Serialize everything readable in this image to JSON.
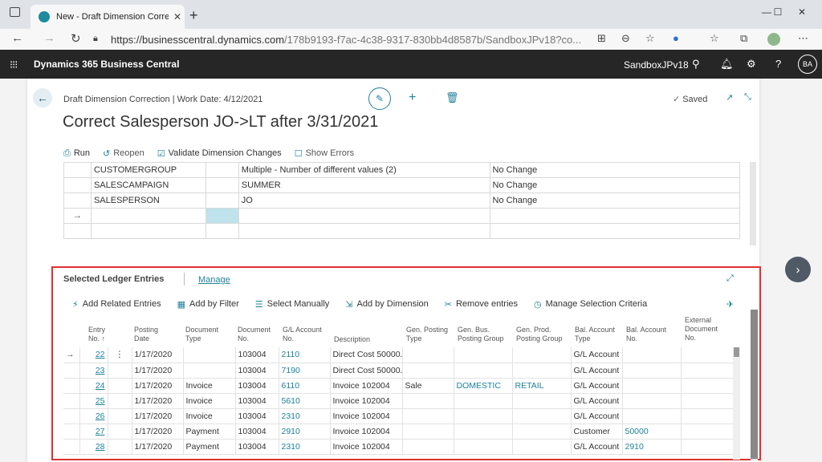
{
  "browser": {
    "tab_title": "New - Draft Dimension Correction",
    "tab_close": "✕",
    "url_host": "https://businesscentral.dynamics.com",
    "url_path": "/178b9193-f7ac-4c38-9317-830bb4d8587b/SandboxJPv18?co...",
    "window": {
      "minimize": "—",
      "maximize": "☐",
      "close": "✕"
    }
  },
  "bc": {
    "app_name": "Dynamics 365 Business Central",
    "environment": "SandboxJPv18",
    "avatar": "BA"
  },
  "page": {
    "breadcrumb": "Draft Dimension Correction | Work Date: 4/12/2021",
    "title": "Correct Salesperson JO->LT after 3/31/2021",
    "saved": "Saved",
    "actions": [
      {
        "label": "Run",
        "icon": "run-icon"
      },
      {
        "label": "Reopen",
        "icon": "reopen-icon"
      },
      {
        "label": "Validate Dimension Changes",
        "icon": "validate-icon"
      },
      {
        "label": "Show Errors",
        "icon": "errors-icon"
      }
    ]
  },
  "dimensions": {
    "rows": [
      {
        "code": "CUSTOMERGROUP",
        "value": "Multiple - Number of different values (2)",
        "new": "No Change"
      },
      {
        "code": "SALESCAMPAIGN",
        "value": "SUMMER",
        "new": "No Change"
      },
      {
        "code": "SALESPERSON",
        "value": "JO",
        "new": "No Change"
      },
      {
        "code": "",
        "value": "",
        "new": ""
      },
      {
        "code": "",
        "value": "",
        "new": ""
      }
    ],
    "new_row_arrow": "→"
  },
  "ledger": {
    "title": "Selected Ledger Entries",
    "manage": "Manage",
    "actions": [
      {
        "label": "Add Related Entries",
        "icon": "related-icon"
      },
      {
        "label": "Add by Filter",
        "icon": "filter-icon"
      },
      {
        "label": "Select Manually",
        "icon": "select-icon"
      },
      {
        "label": "Add by Dimension",
        "icon": "dimension-icon"
      },
      {
        "label": "Remove entries",
        "icon": "remove-icon"
      },
      {
        "label": "Manage Selection Criteria",
        "icon": "criteria-icon"
      }
    ],
    "headers": [
      [
        "Entry",
        "No. ↑"
      ],
      [
        "Posting",
        "Date"
      ],
      [
        "Document",
        "Type"
      ],
      [
        "Document",
        "No."
      ],
      [
        "G/L Account",
        "No."
      ],
      [
        "Description",
        ""
      ],
      [
        "Gen. Posting",
        "Type"
      ],
      [
        "Gen. Bus.",
        "Posting Group"
      ],
      [
        "Gen. Prod.",
        "Posting Group"
      ],
      [
        "Bal. Account",
        "Type"
      ],
      [
        "Bal. Account",
        "No."
      ],
      [
        "External",
        "Document",
        "No."
      ]
    ],
    "rows": [
      {
        "entry": "22",
        "date": "1/17/2020",
        "doctype": "",
        "docno": "103004",
        "gl": "2110",
        "desc": "Direct Cost 50000...",
        "gpt": "",
        "gbpg": "",
        "gppg": "",
        "baltype": "G/L Account",
        "balno": "",
        "ext": ""
      },
      {
        "entry": "23",
        "date": "1/17/2020",
        "doctype": "",
        "docno": "103004",
        "gl": "7190",
        "desc": "Direct Cost 50000...",
        "gpt": "",
        "gbpg": "",
        "gppg": "",
        "baltype": "G/L Account",
        "balno": "",
        "ext": ""
      },
      {
        "entry": "24",
        "date": "1/17/2020",
        "doctype": "Invoice",
        "docno": "103004",
        "gl": "6110",
        "desc": "Invoice 102004",
        "gpt": "Sale",
        "gbpg": "DOMESTIC",
        "gppg": "RETAIL",
        "baltype": "G/L Account",
        "balno": "",
        "ext": ""
      },
      {
        "entry": "25",
        "date": "1/17/2020",
        "doctype": "Invoice",
        "docno": "103004",
        "gl": "5610",
        "desc": "Invoice 102004",
        "gpt": "",
        "gbpg": "",
        "gppg": "",
        "baltype": "G/L Account",
        "balno": "",
        "ext": ""
      },
      {
        "entry": "26",
        "date": "1/17/2020",
        "doctype": "Invoice",
        "docno": "103004",
        "gl": "2310",
        "desc": "Invoice 102004",
        "gpt": "",
        "gbpg": "",
        "gppg": "",
        "baltype": "G/L Account",
        "balno": "",
        "ext": ""
      },
      {
        "entry": "27",
        "date": "1/17/2020",
        "doctype": "Payment",
        "docno": "103004",
        "gl": "2910",
        "desc": "Invoice 102004",
        "gpt": "",
        "gbpg": "",
        "gppg": "",
        "baltype": "Customer",
        "balno": "50000",
        "ext": ""
      },
      {
        "entry": "28",
        "date": "1/17/2020",
        "doctype": "Payment",
        "docno": "103004",
        "gl": "2310",
        "desc": "Invoice 102004",
        "gpt": "",
        "gbpg": "",
        "gppg": "",
        "baltype": "G/L Account",
        "balno": "2910",
        "ext": ""
      }
    ],
    "row_arrow": "→",
    "row_menu": "⋮"
  },
  "colors": {
    "accent": "#1f8299",
    "header_bg": "#262626",
    "highlight_border": "#e0302f"
  }
}
